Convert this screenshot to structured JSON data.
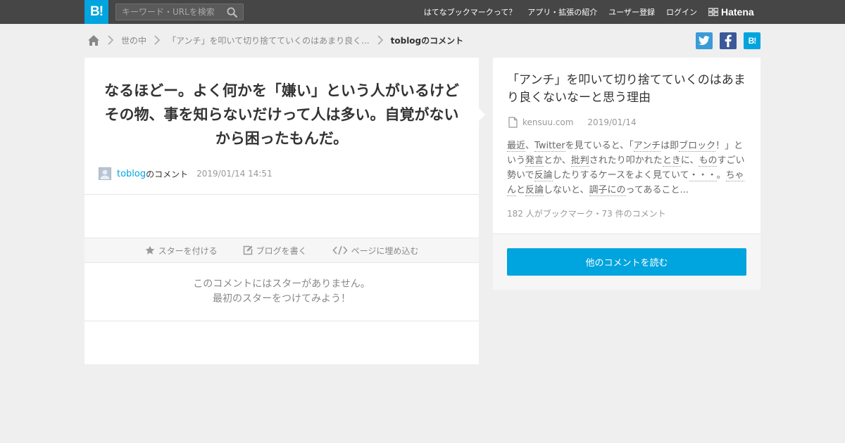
{
  "header": {
    "logo": "B!",
    "search_placeholder": "キーワード・URLを検索",
    "nav": [
      "はてなブックマークって？",
      "アプリ・拡張の紹介",
      "ユーザー登録",
      "ログイン"
    ],
    "brand": "Hatena"
  },
  "breadcrumb": {
    "items": [
      "世の中",
      "「アンチ」を叩いて切り捨てていくのはあまり良く..."
    ],
    "current": "toblogのコメント"
  },
  "share": {
    "twitter": "t",
    "facebook": "f",
    "hatebu": "B!"
  },
  "comment": {
    "text": "なるほどー。よく何かを「嫌い」という人がいるけどその物、事を知らないだけって人は多い。自覚がないから困ったもんだ。",
    "user": "toblog",
    "user_suffix": "のコメント",
    "datetime": "2019/01/14 14:51"
  },
  "actions": {
    "star": "スターを付ける",
    "blog": "ブログを書く",
    "embed": "ページに埋め込む"
  },
  "stars": {
    "line1": "このコメントにはスターがありません。",
    "line2": "最初のスターをつけてみよう！"
  },
  "entry": {
    "title": "「アンチ」を叩いて切り捨てていくのはあまり良くないなーと思う理由",
    "domain": "kensuu.com",
    "date": "2019/01/14",
    "excerpt": [
      {
        "t": "最近",
        "k": true
      },
      {
        "t": "、",
        "k": false
      },
      {
        "t": "Twitter",
        "k": true
      },
      {
        "t": "を見ていると、「",
        "k": false
      },
      {
        "t": "アンチ",
        "k": true
      },
      {
        "t": "は即",
        "k": false
      },
      {
        "t": "ブロック",
        "k": true
      },
      {
        "t": "！」という",
        "k": false
      },
      {
        "t": "発言",
        "k": true
      },
      {
        "t": "とか、",
        "k": false
      },
      {
        "t": "批判",
        "k": true
      },
      {
        "t": "されたり叩かれた",
        "k": false
      },
      {
        "t": "とき",
        "k": true
      },
      {
        "t": "に、",
        "k": false
      },
      {
        "t": "もの",
        "k": true
      },
      {
        "t": "すごい勢いで",
        "k": false
      },
      {
        "t": "反論",
        "k": true
      },
      {
        "t": "したりするケースをよく見ていて",
        "k": false
      },
      {
        "t": "・・・",
        "k": true
      },
      {
        "t": "。",
        "k": false
      },
      {
        "t": "ちゃん",
        "k": true
      },
      {
        "t": "と",
        "k": false
      },
      {
        "t": "反論",
        "k": true
      },
      {
        "t": "しないと、",
        "k": false
      },
      {
        "t": "調子にの",
        "k": true
      },
      {
        "t": "ってあること...",
        "k": false
      }
    ],
    "counts": "182 人がブックマーク・73 件のコメント",
    "read_more": "他のコメントを読む"
  }
}
